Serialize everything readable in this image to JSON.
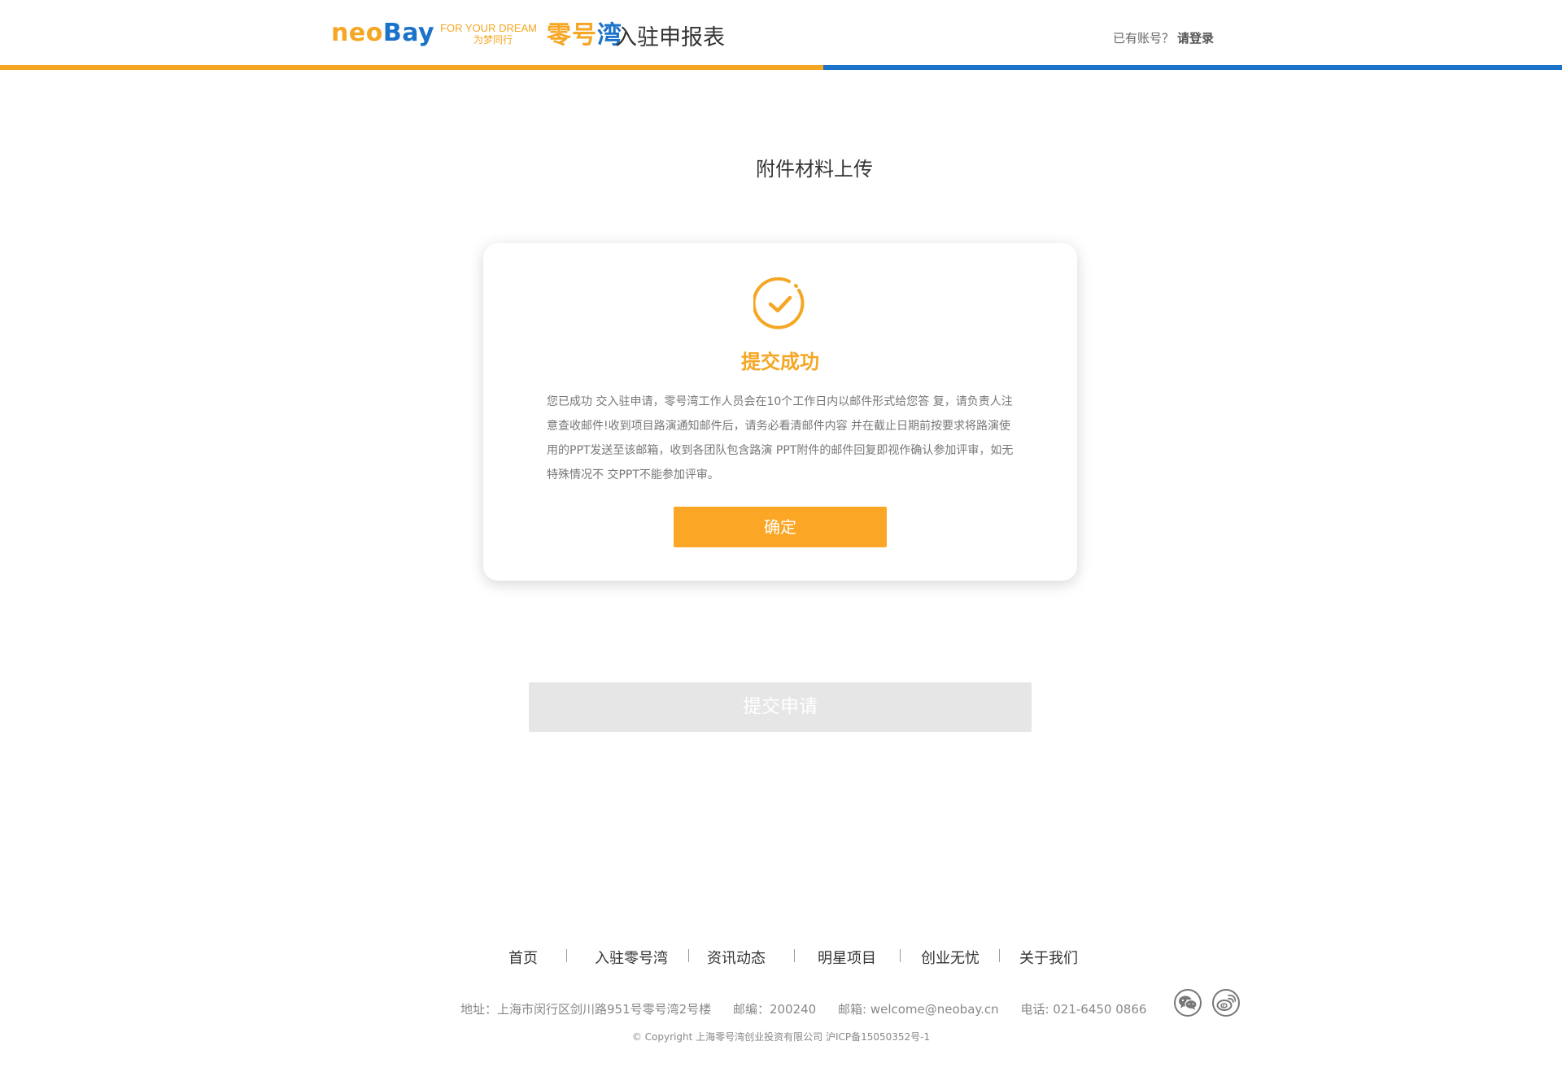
{
  "header": {
    "logo": {
      "brand_part1": "neo",
      "brand_part2": "Bay",
      "slogan_en": "FOR YOUR DREAM",
      "slogan_cn": "为梦同行",
      "name_part1": "零号",
      "name_part2": "湾"
    },
    "page_heading": "入驻申报表",
    "login_prompt": "已有账号？",
    "login_link": "请登录",
    "progress_fraction": 0.527
  },
  "section_title": "附件材料上传",
  "dialog": {
    "icon": "check-circle-icon",
    "title": "提交成功",
    "message": "您已成功 交入驻申请，零号湾工作人员会在10个工作日内以邮件形式给您答 复，请负责人注意查收邮件!收到项目路演通知邮件后，请务必看清邮件内容 并在截止日期前按要求将路演使用的PPT发送至该邮箱，收到各团队包含路演 PPT附件的邮件回复即视作确认参加评审，如无特殊情况不 交PPT不能参加评审。",
    "confirm_label": "确定"
  },
  "submit_label": "提交申请",
  "footer": {
    "nav": [
      "首页",
      "入驻零号湾",
      "资讯动态",
      "明星项目",
      "创业无忧",
      "关于我们"
    ],
    "address": "地址：上海市闵行区剑川路951号零号湾2号楼",
    "postcode": "邮编：200240",
    "email": "邮箱: welcome@neobay.cn",
    "phone": "电话: 021-6450 0866",
    "copyright": "© Copyright 上海零号湾创业投资有限公司 沪ICP备15050352号-1",
    "social": [
      "wechat-icon",
      "weibo-icon"
    ]
  },
  "colors": {
    "accent_orange": "#f5a623",
    "accent_blue": "#1a73c8",
    "button_orange": "#fba725",
    "disabled_gray": "#e6e6e6"
  }
}
